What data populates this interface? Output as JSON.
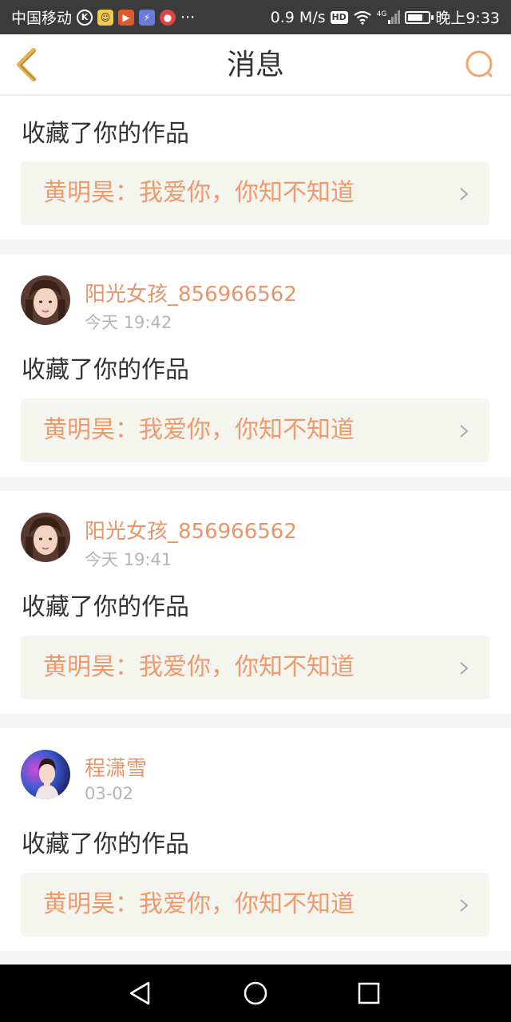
{
  "status_bar": {
    "carrier": "中国移动",
    "network_speed": "0.9 M/s",
    "hd_label": "HD",
    "signal_label": "4G",
    "time": "晚上9:33"
  },
  "header": {
    "title": "消息"
  },
  "colors": {
    "accent": "#e8956a",
    "quote_background": "#f5f5f0",
    "header_icon": "#e7b24b"
  },
  "messages": [
    {
      "action": "收藏了你的作品",
      "quote": "黄明昊：我爱你，你知不知道"
    },
    {
      "username": "阳光女孩_856966562",
      "time": "今天 19:42",
      "action": "收藏了你的作品",
      "quote": "黄明昊：我爱你，你知不知道"
    },
    {
      "username": "阳光女孩_856966562",
      "time": "今天 19:41",
      "action": "收藏了你的作品",
      "quote": "黄明昊：我爱你，你知不知道"
    },
    {
      "username": "程潇雪",
      "time": "03-02",
      "action": "收藏了你的作品",
      "quote": "黄明昊：我爱你，你知不知道"
    }
  ],
  "nav_bar": {
    "back": "back-triangle",
    "home": "home-circle",
    "recents": "recents-square"
  }
}
